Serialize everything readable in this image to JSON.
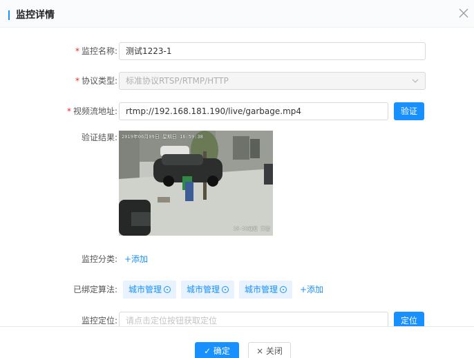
{
  "dialog": {
    "title": "监控详情"
  },
  "form": {
    "name": {
      "label": "监控名称:",
      "value": "测试1223-1"
    },
    "protocol": {
      "label": "协议类型:",
      "value": "标准协议RTSP/RTMP/HTTP"
    },
    "stream": {
      "label": "视频流地址:",
      "value": "rtmp://192.168.181.190/live/garbage.mp4",
      "verify_button": "验证"
    },
    "result": {
      "label": "验证结果:",
      "overlay_timestamp": "2019年06月09日 星期日 16:59:38",
      "overlay_caption": "38-58通道 交警"
    },
    "category": {
      "label": "监控分类:",
      "add_link": "+添加"
    },
    "algorithms": {
      "label": "已绑定算法:",
      "tags": [
        "城市管理",
        "城市管理",
        "城市管理"
      ],
      "add_link": "+添加"
    },
    "location": {
      "label": "监控定位:",
      "placeholder": "请点击定位按钮获取定位",
      "locate_button": "定位"
    }
  },
  "footer": {
    "ok_label": "✓ 确定",
    "cancel_label": "× 关闭"
  },
  "colors": {
    "primary": "#1890ff",
    "required": "#f5222d",
    "tag_bg": "#e8f3ff"
  }
}
